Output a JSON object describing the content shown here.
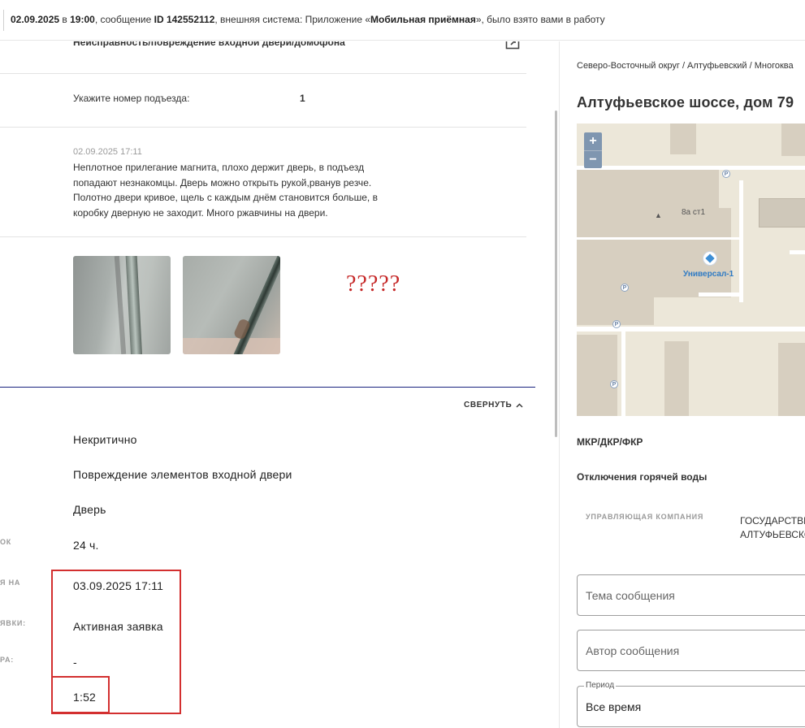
{
  "topbar": {
    "date": "02.09.2025",
    "at": "в",
    "time": "19:00",
    "msg_label": ", сообщение",
    "msg_id": "ID 142552112",
    "ext_label": ", внешняя система: Приложение «",
    "system": "Мобильная приёмная",
    "tail": "», было взято вами в работу"
  },
  "detail": {
    "title": "Неисправность/повреждение входной двери/домофона",
    "porch_label": "Укажите номер подъезда:",
    "porch_value": "1",
    "comment_date": "02.09.2025 17:11",
    "comment_text": "Неплотное прилегание магнита, плохо держит дверь, в подъезд попадают незнакомцы. Дверь можно открыть рукой,рванув резче. Полотно двери кривое, щель с каждым днём становится больше, в коробку дверную не заходит. Много ржавчины на двери.",
    "question_marks": "?????",
    "collapse_label": "СВЕРНУТЬ"
  },
  "fields": {
    "criticality": "Некритично",
    "problem": "Повреждение элементов входной двери",
    "object": "Дверь",
    "term_label": "ОК",
    "term_value": "24 ч.",
    "due_label": "Я НА",
    "due_value": "03.09.2025 17:11",
    "status_label": "ЯВКИ:",
    "status_value": "Активная заявка",
    "other_label": "РА:",
    "other_value": "-",
    "elapsed_value": "1:52"
  },
  "right": {
    "breadcrumb": "Северо-Восточный округ / Алтуфьевский / Многоква",
    "address": "Алтуфьевское шоссе, дом 79",
    "mkr": "МКР/ДКР/ФКР",
    "hot_water": "Отключения горячей воды",
    "uk_label": "УПРАВЛЯЮЩАЯ КОМПАНИЯ",
    "uk_value_1": "ГОСУДАРСТВЕ",
    "uk_value_2": "АЛТУФЬЕВСКО",
    "subject_placeholder": "Тема сообщения",
    "author_placeholder": "Автор сообщения",
    "period_label": "Период",
    "period_value": "Все время"
  },
  "map": {
    "zoom_in": "+",
    "zoom_out": "−",
    "building_label": "8а ст1",
    "poi_label": "Универсал-1",
    "parking": "P"
  },
  "colors": {
    "accent_red": "#d32f2f",
    "navy": "#1a237e",
    "map_zoom": "#7f96b0"
  }
}
